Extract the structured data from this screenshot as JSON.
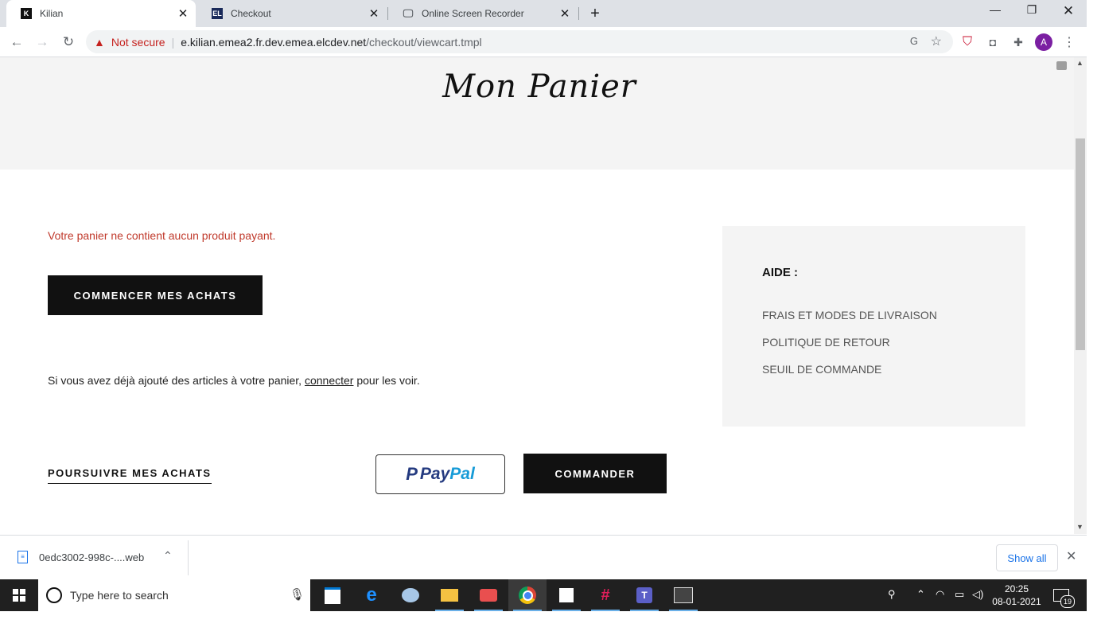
{
  "tabs": [
    {
      "title": "Kilian",
      "favicon": "kilian-favicon"
    },
    {
      "title": "Checkout",
      "favicon": "el-favicon"
    },
    {
      "title": "Online Screen Recorder",
      "favicon": "monitor-icon"
    }
  ],
  "address": {
    "security": "Not secure",
    "host": "e.kilian.emea2.fr.dev.emea.elcdev.net",
    "path": "/checkout/viewcart.tmpl"
  },
  "profile_initial": "A",
  "page": {
    "title": "Mon Panier",
    "empty_message": "Votre panier ne contient aucun produit payant.",
    "start_shopping": "COMMENCER MES ACHATS",
    "signin_before": "Si vous avez déjà ajouté des articles à votre panier, ",
    "signin_link": "connecter",
    "signin_after": " pour les voir.",
    "continue_shopping": "POURSUIVRE MES ACHATS",
    "paypal_pay": "Pay",
    "paypal_pal": "Pal",
    "checkout": "COMMANDER"
  },
  "help": {
    "heading": "AIDE :",
    "links": [
      "FRAIS ET MODES DE LIVRAISON",
      "POLITIQUE DE RETOUR",
      "SEUIL DE COMMANDE"
    ]
  },
  "download": {
    "filename": "0edc3002-998c-....web",
    "show_all": "Show all"
  },
  "taskbar": {
    "search_placeholder": "Type here to search",
    "time": "20:25",
    "date": "08-01-2021",
    "notifications": "19"
  },
  "colors": {
    "error": "#c0392b",
    "brand_black": "#111111",
    "paypal_dark": "#253b80",
    "paypal_light": "#179bd7"
  }
}
